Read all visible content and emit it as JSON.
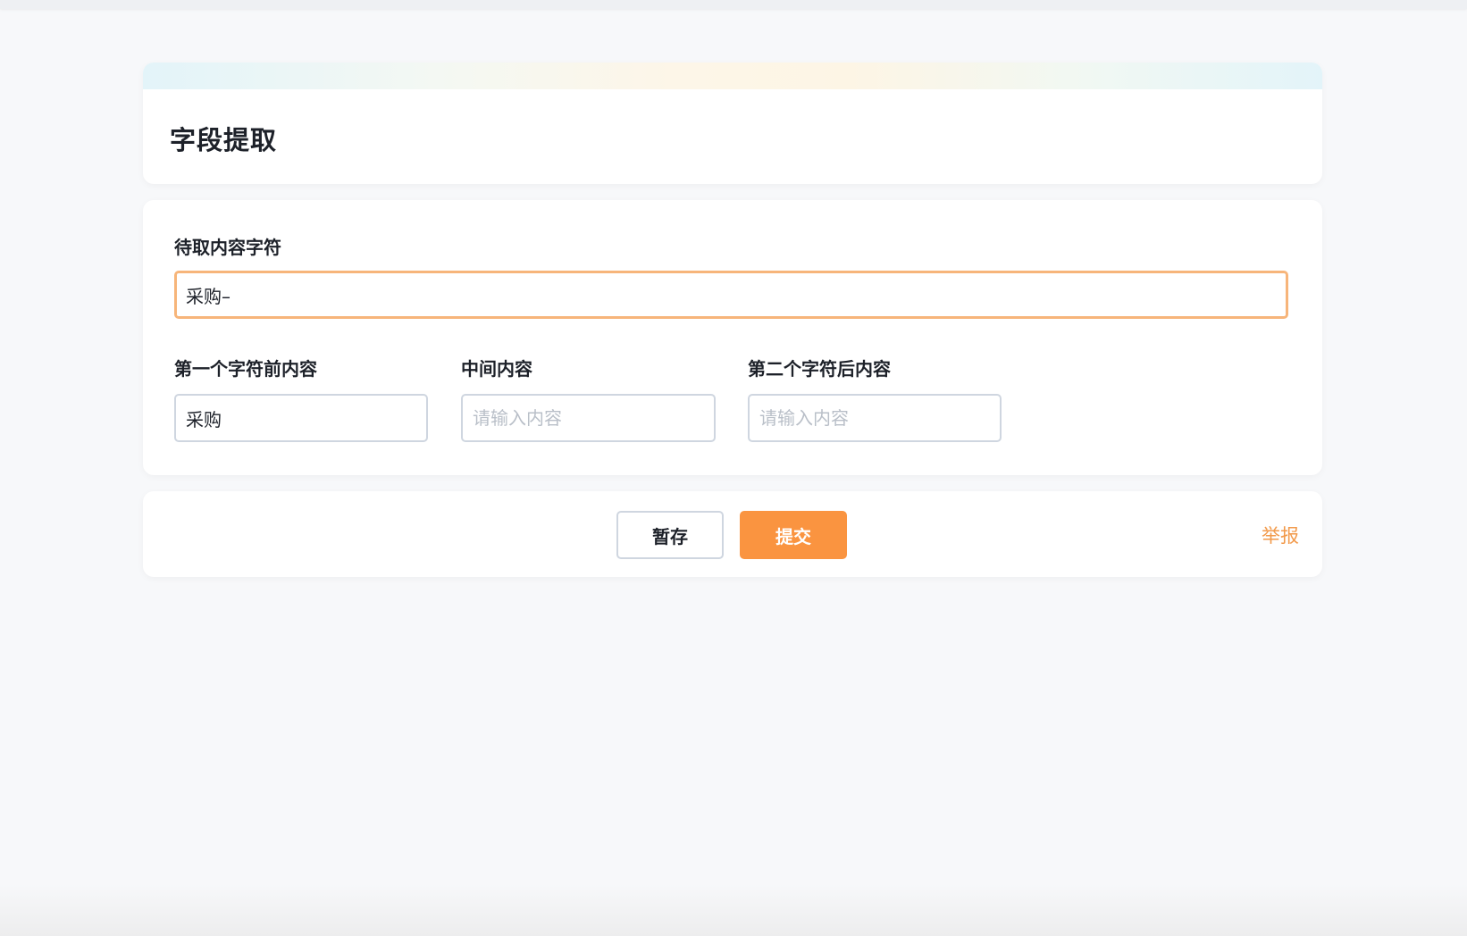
{
  "page": {
    "title": "字段提取"
  },
  "form": {
    "source_label": "待取内容字符",
    "source_value": "采购–",
    "before_label": "第一个字符前内容",
    "before_value": "采购",
    "middle_label": "中间内容",
    "middle_value": "",
    "after_label": "第二个字符后内容",
    "after_value": "",
    "placeholder": "请输入内容"
  },
  "footer": {
    "save_label": "暂存",
    "submit_label": "提交",
    "report_label": "举报"
  },
  "colors": {
    "accent": "#fa9440",
    "focus_border": "#f7b57a",
    "report_link": "#f29a4b",
    "page_background": "#f7f8fa"
  }
}
